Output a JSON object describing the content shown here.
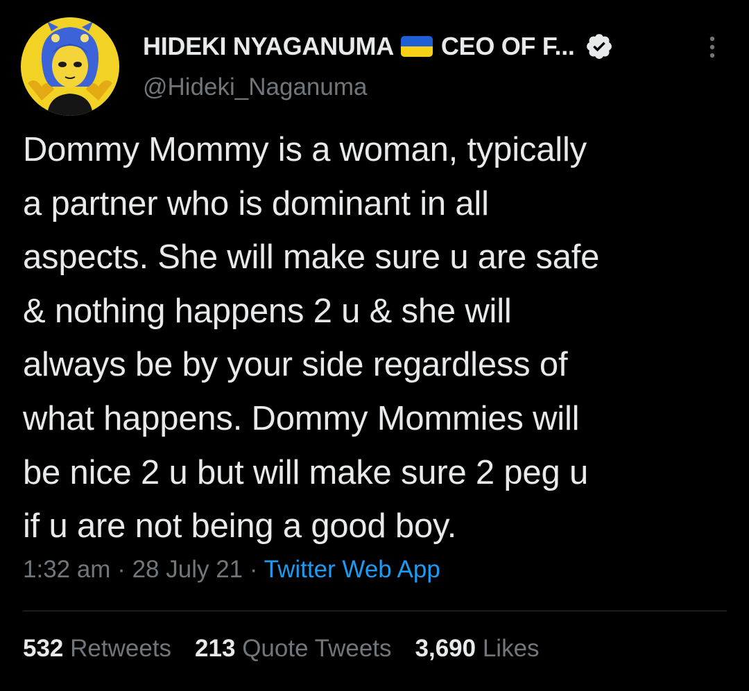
{
  "author": {
    "display_name": "HIDEKI NYAGANUMA",
    "display_name_suffix": "CEO OF F...",
    "handle": "@Hideki_Naganuma",
    "flag_icon": "ukraine-flag-icon",
    "verified_icon": "verified-badge-icon"
  },
  "tweet": {
    "lines": [
      "Dommy Mommy is a woman, typically",
      "a partner who is dominant in all",
      "aspects. She will make sure u are safe",
      "& nothing happens 2 u & she will",
      "always be by your side regardless of",
      "what happens. Dommy Mommies will",
      "be nice 2 u but will make sure 2 peg u",
      "if u are not being a good boy."
    ]
  },
  "meta": {
    "time": "1:32 am",
    "separator": " · ",
    "date": "28 July 21",
    "source": "Twitter Web App"
  },
  "stats": {
    "retweets_count": "532",
    "retweets_label": "Retweets",
    "quote_count": "213",
    "quote_label": "Quote Tweets",
    "likes_count": "3,690",
    "likes_label": "Likes"
  },
  "colors": {
    "background": "#000000",
    "text": "#e7e9ea",
    "muted": "#71767b",
    "link": "#1d9bf0",
    "divider": "#2f3336"
  }
}
